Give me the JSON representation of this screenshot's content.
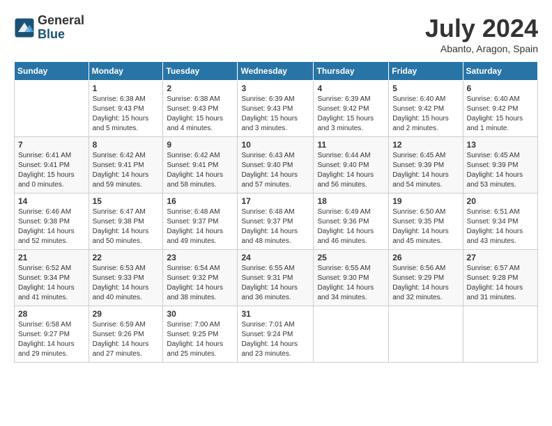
{
  "logo": {
    "general": "General",
    "blue": "Blue"
  },
  "title": "July 2024",
  "location": "Abanto, Aragon, Spain",
  "days_of_week": [
    "Sunday",
    "Monday",
    "Tuesday",
    "Wednesday",
    "Thursday",
    "Friday",
    "Saturday"
  ],
  "weeks": [
    [
      {
        "day": "",
        "sunrise": "",
        "sunset": "",
        "daylight": ""
      },
      {
        "day": "1",
        "sunrise": "Sunrise: 6:38 AM",
        "sunset": "Sunset: 9:43 PM",
        "daylight": "Daylight: 15 hours and 5 minutes."
      },
      {
        "day": "2",
        "sunrise": "Sunrise: 6:38 AM",
        "sunset": "Sunset: 9:43 PM",
        "daylight": "Daylight: 15 hours and 4 minutes."
      },
      {
        "day": "3",
        "sunrise": "Sunrise: 6:39 AM",
        "sunset": "Sunset: 9:43 PM",
        "daylight": "Daylight: 15 hours and 3 minutes."
      },
      {
        "day": "4",
        "sunrise": "Sunrise: 6:39 AM",
        "sunset": "Sunset: 9:42 PM",
        "daylight": "Daylight: 15 hours and 3 minutes."
      },
      {
        "day": "5",
        "sunrise": "Sunrise: 6:40 AM",
        "sunset": "Sunset: 9:42 PM",
        "daylight": "Daylight: 15 hours and 2 minutes."
      },
      {
        "day": "6",
        "sunrise": "Sunrise: 6:40 AM",
        "sunset": "Sunset: 9:42 PM",
        "daylight": "Daylight: 15 hours and 1 minute."
      }
    ],
    [
      {
        "day": "7",
        "sunrise": "Sunrise: 6:41 AM",
        "sunset": "Sunset: 9:41 PM",
        "daylight": "Daylight: 15 hours and 0 minutes."
      },
      {
        "day": "8",
        "sunrise": "Sunrise: 6:42 AM",
        "sunset": "Sunset: 9:41 PM",
        "daylight": "Daylight: 14 hours and 59 minutes."
      },
      {
        "day": "9",
        "sunrise": "Sunrise: 6:42 AM",
        "sunset": "Sunset: 9:41 PM",
        "daylight": "Daylight: 14 hours and 58 minutes."
      },
      {
        "day": "10",
        "sunrise": "Sunrise: 6:43 AM",
        "sunset": "Sunset: 9:40 PM",
        "daylight": "Daylight: 14 hours and 57 minutes."
      },
      {
        "day": "11",
        "sunrise": "Sunrise: 6:44 AM",
        "sunset": "Sunset: 9:40 PM",
        "daylight": "Daylight: 14 hours and 56 minutes."
      },
      {
        "day": "12",
        "sunrise": "Sunrise: 6:45 AM",
        "sunset": "Sunset: 9:39 PM",
        "daylight": "Daylight: 14 hours and 54 minutes."
      },
      {
        "day": "13",
        "sunrise": "Sunrise: 6:45 AM",
        "sunset": "Sunset: 9:39 PM",
        "daylight": "Daylight: 14 hours and 53 minutes."
      }
    ],
    [
      {
        "day": "14",
        "sunrise": "Sunrise: 6:46 AM",
        "sunset": "Sunset: 9:38 PM",
        "daylight": "Daylight: 14 hours and 52 minutes."
      },
      {
        "day": "15",
        "sunrise": "Sunrise: 6:47 AM",
        "sunset": "Sunset: 9:38 PM",
        "daylight": "Daylight: 14 hours and 50 minutes."
      },
      {
        "day": "16",
        "sunrise": "Sunrise: 6:48 AM",
        "sunset": "Sunset: 9:37 PM",
        "daylight": "Daylight: 14 hours and 49 minutes."
      },
      {
        "day": "17",
        "sunrise": "Sunrise: 6:48 AM",
        "sunset": "Sunset: 9:37 PM",
        "daylight": "Daylight: 14 hours and 48 minutes."
      },
      {
        "day": "18",
        "sunrise": "Sunrise: 6:49 AM",
        "sunset": "Sunset: 9:36 PM",
        "daylight": "Daylight: 14 hours and 46 minutes."
      },
      {
        "day": "19",
        "sunrise": "Sunrise: 6:50 AM",
        "sunset": "Sunset: 9:35 PM",
        "daylight": "Daylight: 14 hours and 45 minutes."
      },
      {
        "day": "20",
        "sunrise": "Sunrise: 6:51 AM",
        "sunset": "Sunset: 9:34 PM",
        "daylight": "Daylight: 14 hours and 43 minutes."
      }
    ],
    [
      {
        "day": "21",
        "sunrise": "Sunrise: 6:52 AM",
        "sunset": "Sunset: 9:34 PM",
        "daylight": "Daylight: 14 hours and 41 minutes."
      },
      {
        "day": "22",
        "sunrise": "Sunrise: 6:53 AM",
        "sunset": "Sunset: 9:33 PM",
        "daylight": "Daylight: 14 hours and 40 minutes."
      },
      {
        "day": "23",
        "sunrise": "Sunrise: 6:54 AM",
        "sunset": "Sunset: 9:32 PM",
        "daylight": "Daylight: 14 hours and 38 minutes."
      },
      {
        "day": "24",
        "sunrise": "Sunrise: 6:55 AM",
        "sunset": "Sunset: 9:31 PM",
        "daylight": "Daylight: 14 hours and 36 minutes."
      },
      {
        "day": "25",
        "sunrise": "Sunrise: 6:55 AM",
        "sunset": "Sunset: 9:30 PM",
        "daylight": "Daylight: 14 hours and 34 minutes."
      },
      {
        "day": "26",
        "sunrise": "Sunrise: 6:56 AM",
        "sunset": "Sunset: 9:29 PM",
        "daylight": "Daylight: 14 hours and 32 minutes."
      },
      {
        "day": "27",
        "sunrise": "Sunrise: 6:57 AM",
        "sunset": "Sunset: 9:28 PM",
        "daylight": "Daylight: 14 hours and 31 minutes."
      }
    ],
    [
      {
        "day": "28",
        "sunrise": "Sunrise: 6:58 AM",
        "sunset": "Sunset: 9:27 PM",
        "daylight": "Daylight: 14 hours and 29 minutes."
      },
      {
        "day": "29",
        "sunrise": "Sunrise: 6:59 AM",
        "sunset": "Sunset: 9:26 PM",
        "daylight": "Daylight: 14 hours and 27 minutes."
      },
      {
        "day": "30",
        "sunrise": "Sunrise: 7:00 AM",
        "sunset": "Sunset: 9:25 PM",
        "daylight": "Daylight: 14 hours and 25 minutes."
      },
      {
        "day": "31",
        "sunrise": "Sunrise: 7:01 AM",
        "sunset": "Sunset: 9:24 PM",
        "daylight": "Daylight: 14 hours and 23 minutes."
      },
      {
        "day": "",
        "sunrise": "",
        "sunset": "",
        "daylight": ""
      },
      {
        "day": "",
        "sunrise": "",
        "sunset": "",
        "daylight": ""
      },
      {
        "day": "",
        "sunrise": "",
        "sunset": "",
        "daylight": ""
      }
    ]
  ]
}
